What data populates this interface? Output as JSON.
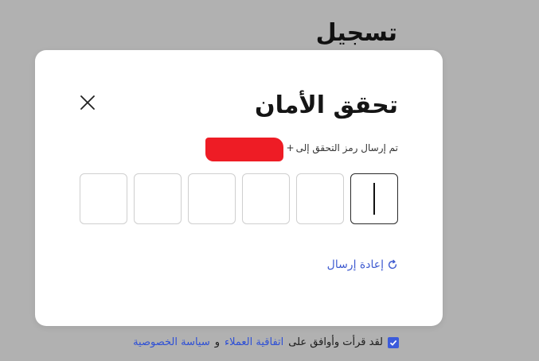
{
  "background": {
    "title": "تسجيل",
    "terms": {
      "prefix": "لقد قرأت وأوافق على",
      "customer_agreement": "اتفاقية العملاء",
      "and": "و",
      "privacy_policy": "سياسة الخصوصية",
      "checked": true
    }
  },
  "modal": {
    "title": "تحقق الأمان",
    "subtitle": "تم إرسال رمز التحقق إلى",
    "phone_prefix": "+",
    "otp_length": 6,
    "resend_label": "إعادة إرسال"
  },
  "icons": {
    "close": "close-icon",
    "resend": "refresh-icon",
    "checkbox": "check-icon"
  },
  "colors": {
    "overlay": "#b1b1b1",
    "accent": "#3b5bdb",
    "link": "#2d4fd6",
    "redaction": "#ee1c25"
  }
}
